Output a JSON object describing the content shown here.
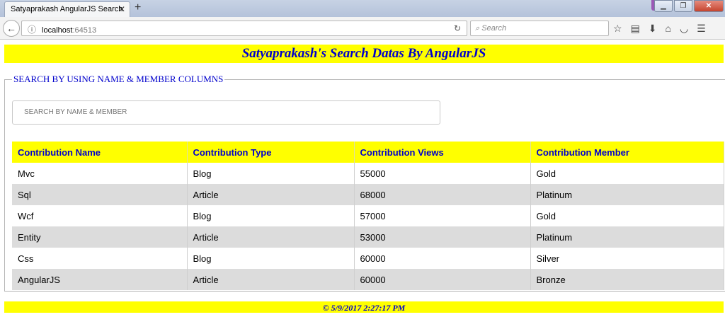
{
  "browser": {
    "tab_title": "Satyaprakash AngularJS Search",
    "url_host": "localhost",
    "url_port": ":64513",
    "search_placeholder": "Search"
  },
  "page": {
    "header": "Satyaprakash's Search Datas By AngularJS",
    "legend": "SEARCH BY USING NAME & MEMBER COLUMNS",
    "search_placeholder": "SEARCH BY NAME & MEMBER",
    "footer": "© 5/9/2017 2:27:17 PM"
  },
  "table": {
    "headers": [
      "Contribution Name",
      "Contribution Type",
      "Contribution Views",
      "Contribution Member"
    ],
    "rows": [
      [
        "Mvc",
        "Blog",
        "55000",
        "Gold"
      ],
      [
        "Sql",
        "Article",
        "68000",
        "Platinum"
      ],
      [
        "Wcf",
        "Blog",
        "57000",
        "Gold"
      ],
      [
        "Entity",
        "Article",
        "53000",
        "Platinum"
      ],
      [
        "Css",
        "Blog",
        "60000",
        "Silver"
      ],
      [
        "AngularJS",
        "Article",
        "60000",
        "Bronze"
      ]
    ]
  },
  "colors": {
    "band": "#ffff00",
    "accent_text": "#0000cc",
    "row_alt": "#dcdcdc"
  }
}
